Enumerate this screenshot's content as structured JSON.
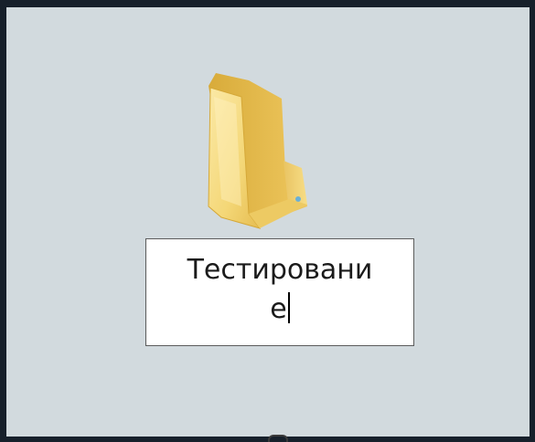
{
  "folder": {
    "icon": "folder-icon",
    "name_edit": {
      "line1": "Тестировани",
      "line2": "е"
    }
  },
  "colors": {
    "desktop_bg": "#d2dade",
    "frame_bg": "#17202b",
    "folder_front": "#f3d36b",
    "folder_back": "#e2b94a"
  }
}
